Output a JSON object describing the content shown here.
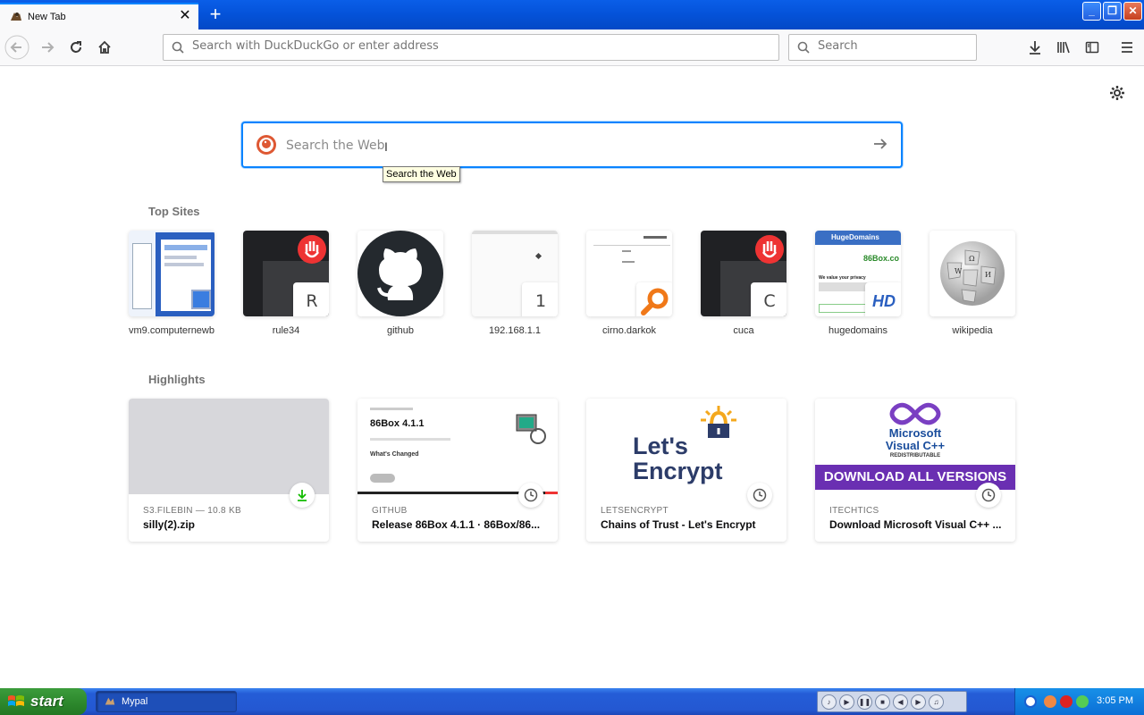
{
  "tab": {
    "title": "New Tab",
    "close": "✕",
    "new_tab": "+"
  },
  "window_buttons": {
    "minimize": "_",
    "maximize": "❐",
    "close": "✕"
  },
  "toolbar": {
    "url_placeholder": "Search with DuckDuckGo or enter address",
    "search_placeholder": "Search"
  },
  "newtab": {
    "search_placeholder": "Search the Web",
    "tooltip": "Search the Web",
    "top_sites_title": "Top Sites",
    "highlights_title": "Highlights",
    "top_sites": [
      {
        "label": "vm9.computernewb"
      },
      {
        "label": "rule34",
        "letter": "R"
      },
      {
        "label": "github"
      },
      {
        "label": "192.168.1.1",
        "letter": "1"
      },
      {
        "label": "cirno.darkok"
      },
      {
        "label": "cuca",
        "letter": "C"
      },
      {
        "label": "hugedomains",
        "badge": "HD",
        "preview_brand": "HugeDomains",
        "preview_text": "86Box.co",
        "preview_note": "We value your privacy"
      },
      {
        "label": "wikipedia"
      }
    ],
    "highlights": [
      {
        "source": "S3.FILEBIN — 10.8 KB",
        "title": "silly(2).zip",
        "icon": "download-icon"
      },
      {
        "source": "GITHUB",
        "title": "Release 86Box 4.1.1 · 86Box/86...",
        "icon": "clock-icon",
        "preview_heading": "86Box 4.1.1",
        "preview_sub": "What's Changed"
      },
      {
        "source": "LETSENCRYPT",
        "title": "Chains of Trust - Let's Encrypt",
        "icon": "clock-icon",
        "preview_line1": "Let's",
        "preview_line2": "Encrypt"
      },
      {
        "source": "ITECHTICS",
        "title": "Download Microsoft Visual C++ ...",
        "icon": "clock-icon",
        "preview_brand1": "Microsoft",
        "preview_brand2": "Visual C++",
        "preview_brand3": "REDISTRIBUTABLE",
        "preview_banner": "DOWNLOAD ALL VERSIONS"
      }
    ]
  },
  "taskbar": {
    "start": "start",
    "task": "Mypal",
    "clock": "3:05 PM"
  },
  "colors": {
    "accent": "#0a84ff",
    "taskbar": "#245dd7",
    "start": "#2e8a2e"
  }
}
